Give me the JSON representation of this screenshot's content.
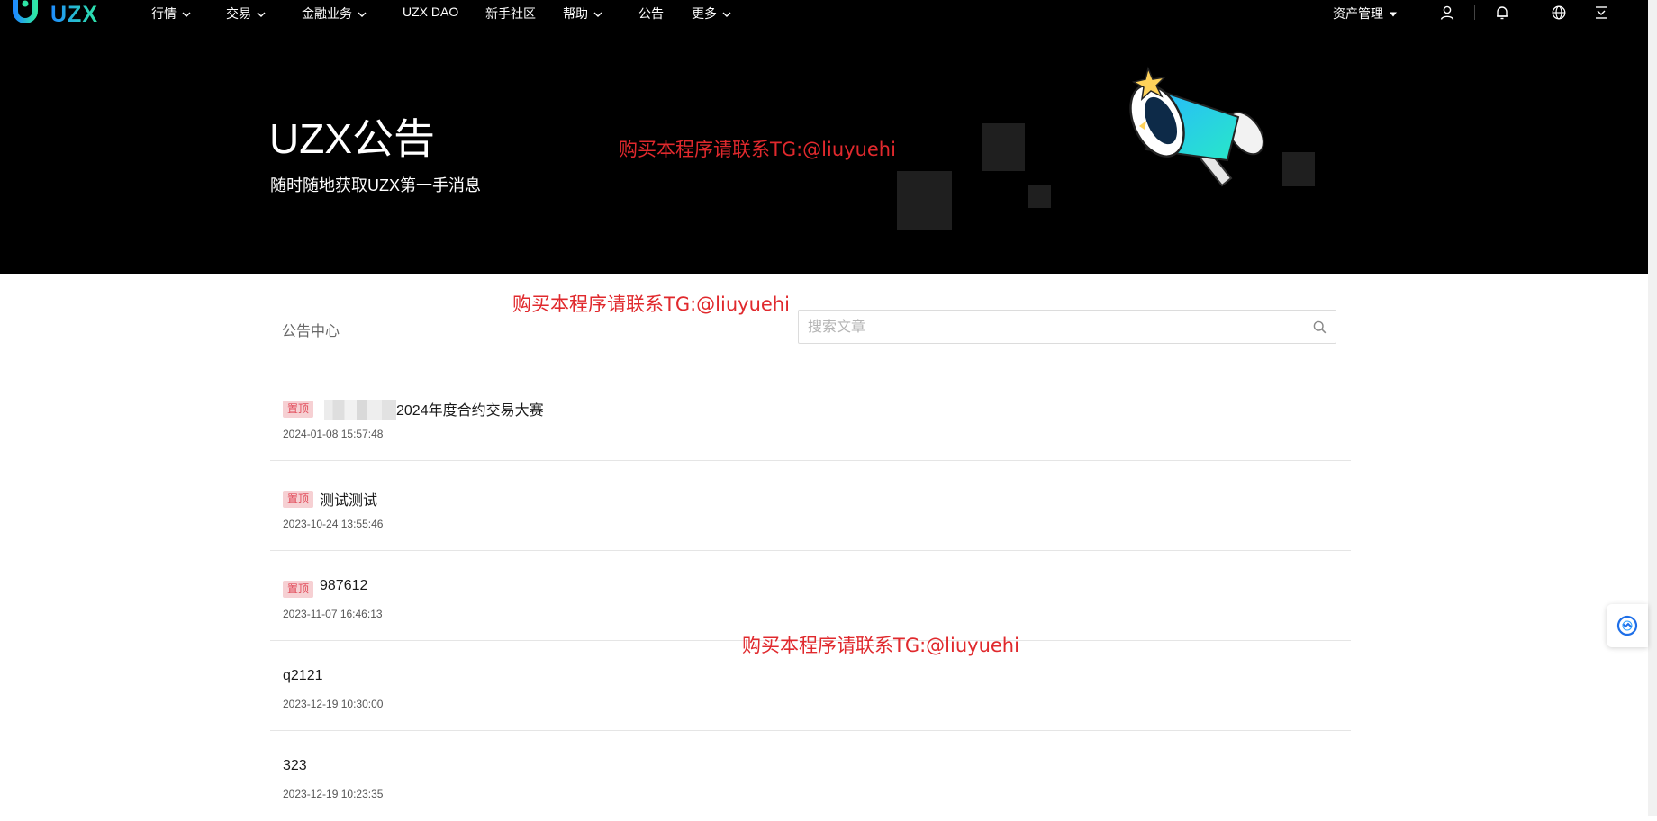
{
  "nav": {
    "logo_text": "UZX",
    "items": [
      {
        "label": "行情",
        "has_dropdown": true
      },
      {
        "label": "交易",
        "has_dropdown": true
      },
      {
        "label": "金融业务",
        "has_dropdown": true
      },
      {
        "label": "UZX DAO",
        "has_dropdown": false
      },
      {
        "label": "新手社区",
        "has_dropdown": false
      },
      {
        "label": "帮助",
        "has_dropdown": true
      },
      {
        "label": "公告",
        "has_dropdown": false
      },
      {
        "label": "更多",
        "has_dropdown": true
      }
    ],
    "assets": "资产管理",
    "icons": [
      "user-icon",
      "bell-icon",
      "globe-icon",
      "download-icon"
    ]
  },
  "hero": {
    "title": "UZX公告",
    "subtitle": "随时随地获取UZX第一手消息",
    "illustration": "megaphone-icon"
  },
  "watermark": "购买本程序请联系TG:@liuyuehi",
  "breadcrumb": "公告中心",
  "search": {
    "placeholder": "搜索文章",
    "value": ""
  },
  "pinned_label": "置顶",
  "articles": [
    {
      "pinned": true,
      "title": "2024年度合约交易大赛",
      "date": "2024-01-08 15:57:48",
      "title_prefix_obscured": true
    },
    {
      "pinned": true,
      "title": "测试测试",
      "date": "2023-10-24 13:55:46"
    },
    {
      "pinned": true,
      "title": "987612",
      "date": "2023-11-07 16:46:13"
    },
    {
      "pinned": false,
      "title": "q2121",
      "date": "2023-12-19 10:30:00"
    },
    {
      "pinned": false,
      "title": "323",
      "date": "2023-12-19 10:23:35"
    }
  ],
  "colors": {
    "nav_bg": "#000000",
    "hero_bg": "#000000",
    "badge_bg": "#f6d0d3",
    "badge_text": "#e24d5b",
    "watermark": "#e0292d",
    "brand_gradient_start": "#1e8bff",
    "brand_gradient_end": "#2ee6a6"
  }
}
